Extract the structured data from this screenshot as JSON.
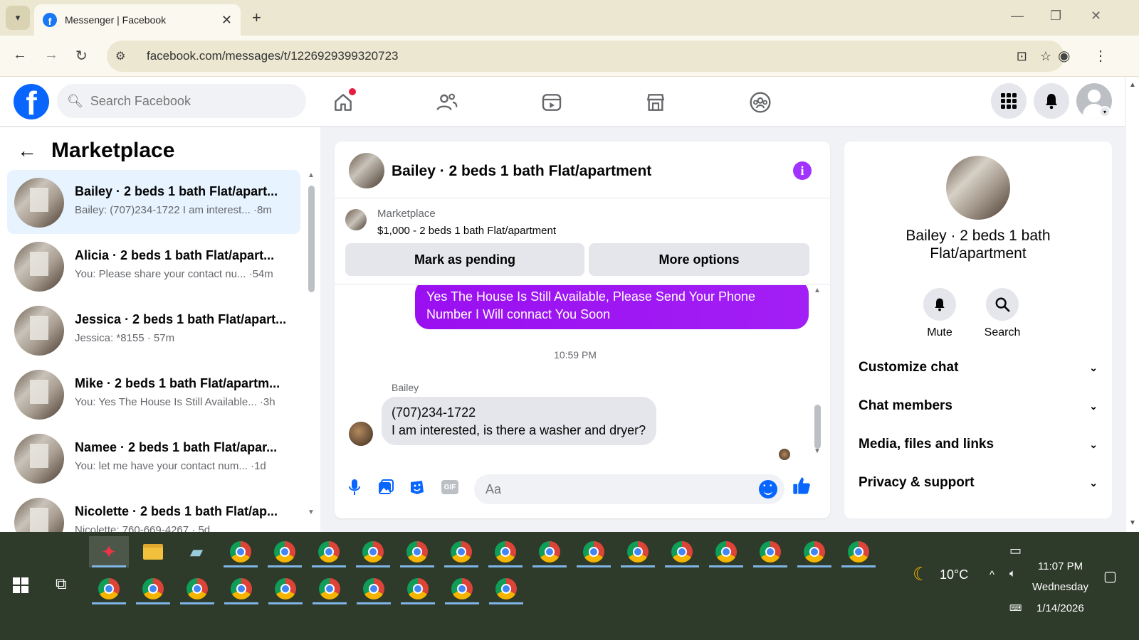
{
  "browser": {
    "tab_title": "Messenger | Facebook",
    "favicon": "f",
    "url": "facebook.com/messages/t/1226929399320723"
  },
  "fb": {
    "logo": "f",
    "search_placeholder": "Search Facebook"
  },
  "left": {
    "title": "Marketplace",
    "conversations": [
      {
        "name": "Bailey · 2 beds 1 bath Flat/apart...",
        "preview": "Bailey: (707)234-1722 I am interest... ·8m",
        "active": true
      },
      {
        "name": "Alicia · 2 beds 1 bath Flat/apart...",
        "preview": "You: Please share your contact nu... ·54m"
      },
      {
        "name": "Jessica · 2 beds 1 bath Flat/apart...",
        "preview": "Jessica: *8155 · 57m"
      },
      {
        "name": "Mike · 2 beds 1 bath Flat/apartm...",
        "preview": "You: Yes The House Is Still Available... ·3h"
      },
      {
        "name": "Namee · 2 beds 1 bath Flat/apar...",
        "preview": "You: let me have your contact num... ·1d"
      },
      {
        "name": "Nicolette · 2 beds 1 bath Flat/ap...",
        "preview": "Nicolette: 760-669-4267 · 5d"
      }
    ]
  },
  "chat": {
    "title": "Bailey · 2 beds 1 bath Flat/apartment",
    "listing_source": "Marketplace",
    "listing_price": "$1,000 - 2 beds 1 bath Flat/apartment",
    "btn_pending": "Mark as pending",
    "btn_more": "More options",
    "outgoing": "Yes The House Is Still Available, Please Send Your Phone Number I Will connact You Soon",
    "timestamp": "10:59 PM",
    "sender": "Bailey",
    "incoming_line1": "(707)234-1722",
    "incoming_line2": "I am interested, is there a washer and dryer?",
    "composer_placeholder": "Aa",
    "gif_label": "GIF"
  },
  "details": {
    "name_line1": "Bailey · 2 beds 1 bath",
    "name_line2": "Flat/apartment",
    "mute_label": "Mute",
    "search_label": "Search",
    "sections": [
      "Customize chat",
      "Chat members",
      "Media, files and links",
      "Privacy & support"
    ]
  },
  "taskbar": {
    "time": "11:07 PM",
    "day": "Wednesday",
    "date": "1/14/2026",
    "weather": "10°C"
  },
  "colors": {
    "accent": "#0866ff",
    "message_purple": "#a033ff",
    "active_row": "#e7f3ff"
  }
}
